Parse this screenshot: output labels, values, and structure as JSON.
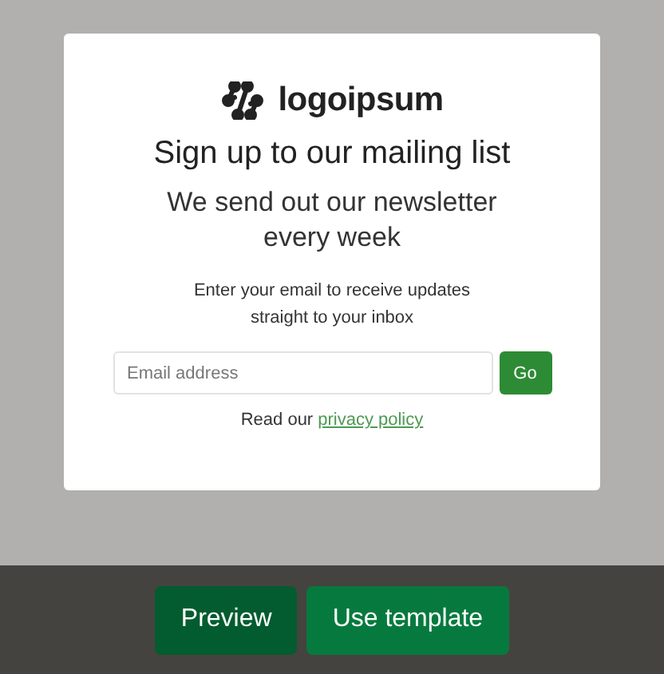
{
  "card": {
    "logo_text": "logoipsum",
    "title": "Sign up to our mailing list",
    "subtitle": "We send out our newsletter every week",
    "description": "Enter your email to receive updates straight to your inbox",
    "email": {
      "placeholder": "Email address"
    },
    "submit": "Go",
    "privacy": {
      "prefix": "Read our",
      "link": "privacy policy"
    }
  },
  "footer": {
    "buttons": [
      {
        "label": "Preview",
        "kind": "secondary"
      },
      {
        "label": "Use template",
        "kind": "primary"
      }
    ]
  }
}
